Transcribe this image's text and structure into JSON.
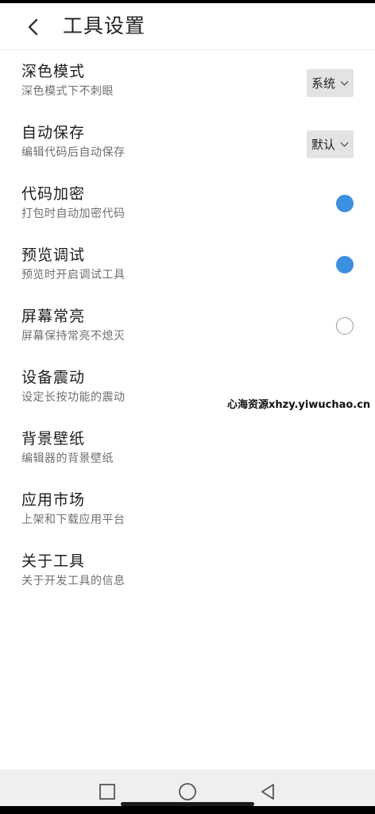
{
  "header": {
    "title": "工具设置"
  },
  "settings": [
    {
      "title": "深色模式",
      "subtitle": "深色模式下不刺眼",
      "control": "dropdown",
      "value": "系统"
    },
    {
      "title": "自动保存",
      "subtitle": "编辑代码后自动保存",
      "control": "dropdown",
      "value": "默认"
    },
    {
      "title": "代码加密",
      "subtitle": "打包时自动加密代码",
      "control": "radio",
      "checked": true
    },
    {
      "title": "预览调试",
      "subtitle": "预览时开启调试工具",
      "control": "radio",
      "checked": true
    },
    {
      "title": "屏幕常亮",
      "subtitle": "屏幕保持常亮不熄灭",
      "control": "radio",
      "checked": false
    },
    {
      "title": "设备震动",
      "subtitle": "设定长按功能的震动",
      "control": "none"
    },
    {
      "title": "背景壁纸",
      "subtitle": "编辑器的背景壁纸",
      "control": "none"
    },
    {
      "title": "应用市场",
      "subtitle": "上架和下载应用平台",
      "control": "none"
    },
    {
      "title": "关于工具",
      "subtitle": "关于开发工具的信息",
      "control": "none"
    }
  ],
  "watermark": "心海资源xhzy.yiwuchao.cn",
  "colors": {
    "accent": "#3d8fe0",
    "dropdown_bg": "#e3e3e3",
    "navbar_bg": "#efefef",
    "title_text": "#1c1c1c",
    "subtitle_text": "#6f6f6f"
  },
  "icons": {
    "back": "chevron-left-icon",
    "dropdown": "chevron-down-icon",
    "nav_recents": "square-icon",
    "nav_home": "circle-icon",
    "nav_back": "triangle-left-icon"
  }
}
